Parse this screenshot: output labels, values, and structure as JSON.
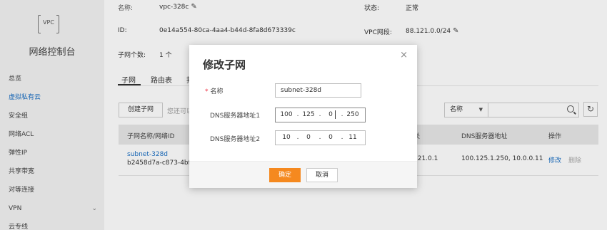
{
  "sidebar": {
    "logo_text": "VPC",
    "title": "网络控制台",
    "items": [
      {
        "label": "总览",
        "active": false
      },
      {
        "label": "虚拟私有云",
        "active": true
      },
      {
        "label": "安全组",
        "active": false
      },
      {
        "label": "网络ACL",
        "active": false
      },
      {
        "label": "弹性IP",
        "active": false
      },
      {
        "label": "共享带宽",
        "active": false
      },
      {
        "label": "对等连接",
        "active": false
      },
      {
        "label": "VPN",
        "active": false,
        "expandable": true
      },
      {
        "label": "云专线",
        "active": false
      }
    ]
  },
  "detail": {
    "name_label": "名称:",
    "name_value": "vpc-328c",
    "status_label": "状态:",
    "status_value": "正常",
    "id_label": "ID:",
    "id_value": "0e14a554-80ca-4aa4-b44d-8fa8d673339c",
    "cidr_label": "VPC网段:",
    "cidr_value": "88.121.0.0/24",
    "subnet_count_label": "子网个数:",
    "subnet_count_value": "1 个"
  },
  "tabs": [
    {
      "label": "子网",
      "active": true
    },
    {
      "label": "路由表",
      "active": false
    },
    {
      "label": "拓",
      "active": false
    }
  ],
  "toolbar": {
    "create_label": "创建子网",
    "hint": "您还可以",
    "filter_value": "名称",
    "search_placeholder": ""
  },
  "table": {
    "headers": [
      "子网名称/网络ID",
      "关",
      "DNS服务器地址",
      "操作"
    ],
    "rows": [
      {
        "name": "subnet-328d",
        "id": "b2458d7a-c873-4bf",
        "gateway": "121.0.1",
        "dns": "100.125.1.250, 10.0.0.11",
        "edit": "修改",
        "delete": "删除"
      }
    ]
  },
  "modal": {
    "title": "修改子网",
    "close": "×",
    "name_label": "名称",
    "required_mark": "*",
    "name_value": "subnet-328d",
    "dns1_label": "DNS服务器地址1",
    "dns1": [
      "100",
      "125",
      "0",
      "250"
    ],
    "dns2_label": "DNS服务器地址2",
    "dns2": [
      "10",
      "0",
      "0",
      "11"
    ],
    "ip_dot": ".",
    "ok_label": "确定",
    "cancel_label": "取消"
  },
  "colors": {
    "accent": "#f5891f",
    "link": "#1a6fc4"
  },
  "icons": {
    "edit": "pencil-icon",
    "search": "search-icon",
    "refresh": "refresh-icon",
    "close": "close-icon",
    "dropdown": "caret-down-icon",
    "expand": "chevron-down-icon"
  }
}
